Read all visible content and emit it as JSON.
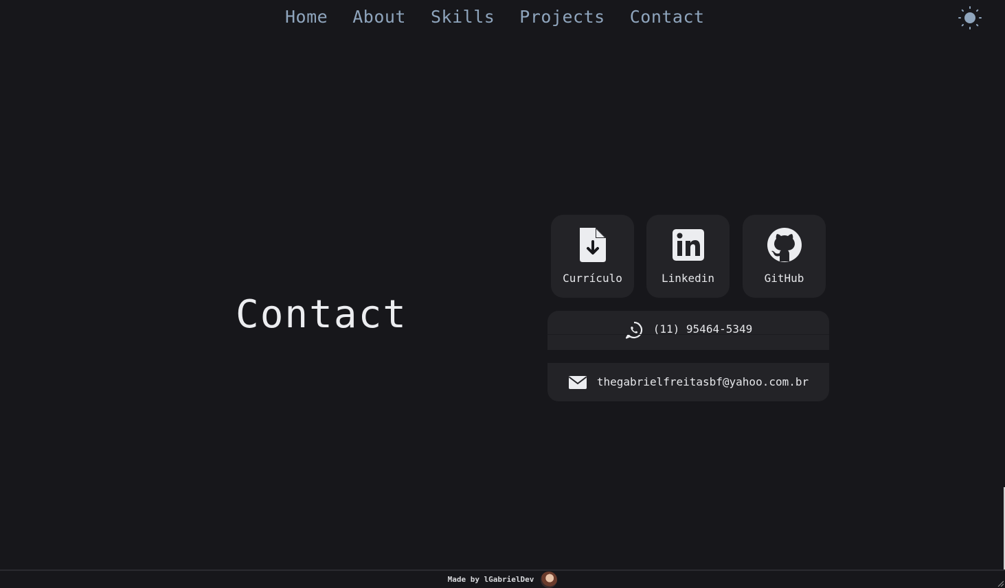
{
  "nav": {
    "items": [
      {
        "label": "Home"
      },
      {
        "label": "About"
      },
      {
        "label": "Skills"
      },
      {
        "label": "Projects"
      },
      {
        "label": "Contact"
      }
    ],
    "theme_icon": "sun-icon"
  },
  "contact": {
    "title": "Contact",
    "cards": [
      {
        "label": "Currículo",
        "icon": "file-download-icon"
      },
      {
        "label": "Linkedin",
        "icon": "linkedin-icon"
      },
      {
        "label": "GitHub",
        "icon": "github-icon"
      }
    ],
    "phone": {
      "text": "(11) 95464-5349",
      "icon": "whatsapp-icon"
    },
    "email": {
      "text": "thegabrielfreitasbf@yahoo.com.br",
      "icon": "envelope-icon"
    }
  },
  "footer": {
    "text": "Made by lGabrielDev"
  },
  "colors": {
    "background": "#17171b",
    "card": "#232327",
    "nav_link": "#8fa5bd",
    "text": "#e6e7ea"
  }
}
